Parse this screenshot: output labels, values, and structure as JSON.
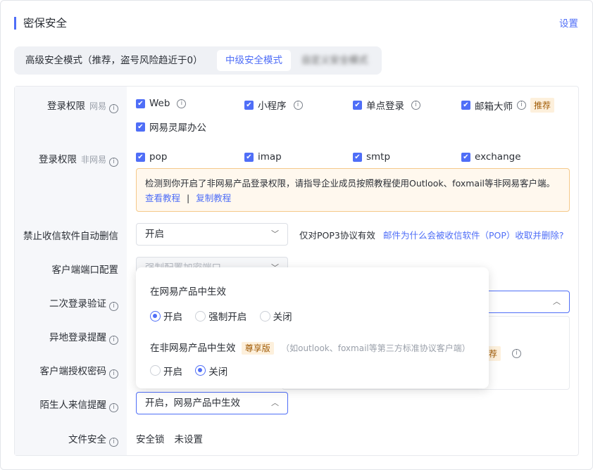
{
  "title": "密保安全",
  "settings": "设置",
  "modes": [
    "高级安全模式（推荐，盗号风险趋近于0）",
    "中级安全模式",
    "自定义安全模式"
  ],
  "rows": {
    "login_netease": {
      "label": "登录权限",
      "sub": "网易",
      "items": [
        "Web",
        "小程序",
        "单点登录",
        "邮箱大师",
        "网易灵犀办公"
      ],
      "tag": "推荐"
    },
    "login_other": {
      "label": "登录权限",
      "sub": "非网易",
      "items": [
        "pop",
        "imap",
        "smtp",
        "exchange"
      ]
    },
    "notice": {
      "text": "检测到你开启了非网易产品登录权限，请指导企业成员按照教程使用Outlook、foxmail等非网易客户端。",
      "link1": "查看教程",
      "sep": "|",
      "link2": "复制教程"
    },
    "auto_delete": {
      "label": "禁止收信软件自动删信",
      "value": "开启",
      "hint": "仅对POP3协议有效",
      "link": "邮件为什么会被收信软件（POP）收取并删除?"
    },
    "port": {
      "label": "客户端端口配置",
      "value": "强制配置加密端口"
    },
    "second_login": {
      "label": "二次登录验证"
    },
    "remote": {
      "label": "异地登录提醒"
    },
    "auth_code": {
      "label": "客户端授权密码",
      "tag_partial": "荐"
    },
    "stranger": {
      "label": "陌生人来信提醒",
      "value": "开启，网易产品中生效"
    },
    "file": {
      "label": "文件安全",
      "k": "安全锁",
      "v": "未设置"
    }
  },
  "popup": {
    "sec1": "在网易产品中生效",
    "opts1": [
      "开启",
      "强制开启",
      "关闭"
    ],
    "sel1": 0,
    "sec2": "在非网易产品中生效",
    "tag": "尊享版",
    "note": "（如outlook、foxmail等第三方标准协议客户端）",
    "opts2": [
      "开启",
      "关闭"
    ],
    "sel2": 1
  }
}
